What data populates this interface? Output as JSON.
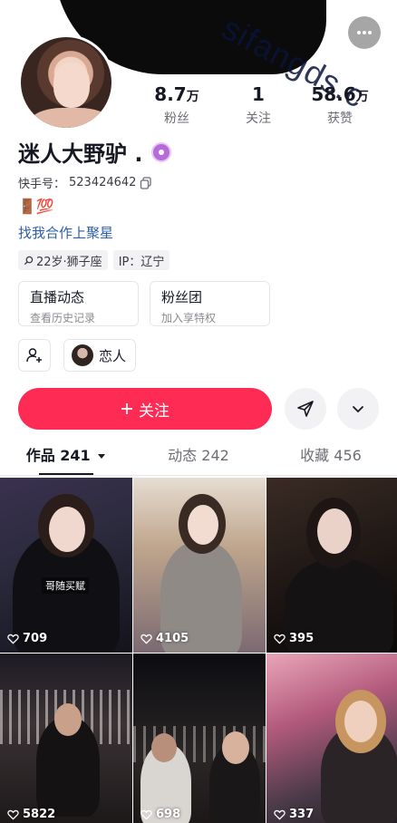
{
  "watermark": "sifangds.c",
  "profile": {
    "nickname": "迷人大野驴 .",
    "account_label": "快手号：",
    "account_id": "523424642",
    "emojis": "🚪💯",
    "cooperate_link": "找我合作上聚星",
    "tags": [
      {
        "icon": "search-icon",
        "label": "22岁·狮子座"
      },
      {
        "label": "IP：辽宁"
      }
    ]
  },
  "stats": [
    {
      "value": "8.7",
      "unit": "万",
      "label": "粉丝"
    },
    {
      "value": "1",
      "unit": "",
      "label": "关注"
    },
    {
      "value": "58.6",
      "unit": "万",
      "label": "获赞"
    }
  ],
  "cards": [
    {
      "title": "直播动态",
      "subtitle": "查看历史记录"
    },
    {
      "title": "粉丝团",
      "subtitle": "加入享特权"
    }
  ],
  "chips": {
    "lover_label": "恋人"
  },
  "actions": {
    "follow_label": "关注",
    "accent": "#fe2c55"
  },
  "tabs": [
    {
      "label": "作品 241",
      "active": true
    },
    {
      "label": "动态 242",
      "active": false
    },
    {
      "label": "收藏 456",
      "active": false
    }
  ],
  "videos": [
    {
      "likes": "709",
      "caption": "哥随买赋"
    },
    {
      "likes": "4105"
    },
    {
      "likes": "395"
    },
    {
      "likes": "5822"
    },
    {
      "likes": "698"
    },
    {
      "likes": "337"
    }
  ]
}
